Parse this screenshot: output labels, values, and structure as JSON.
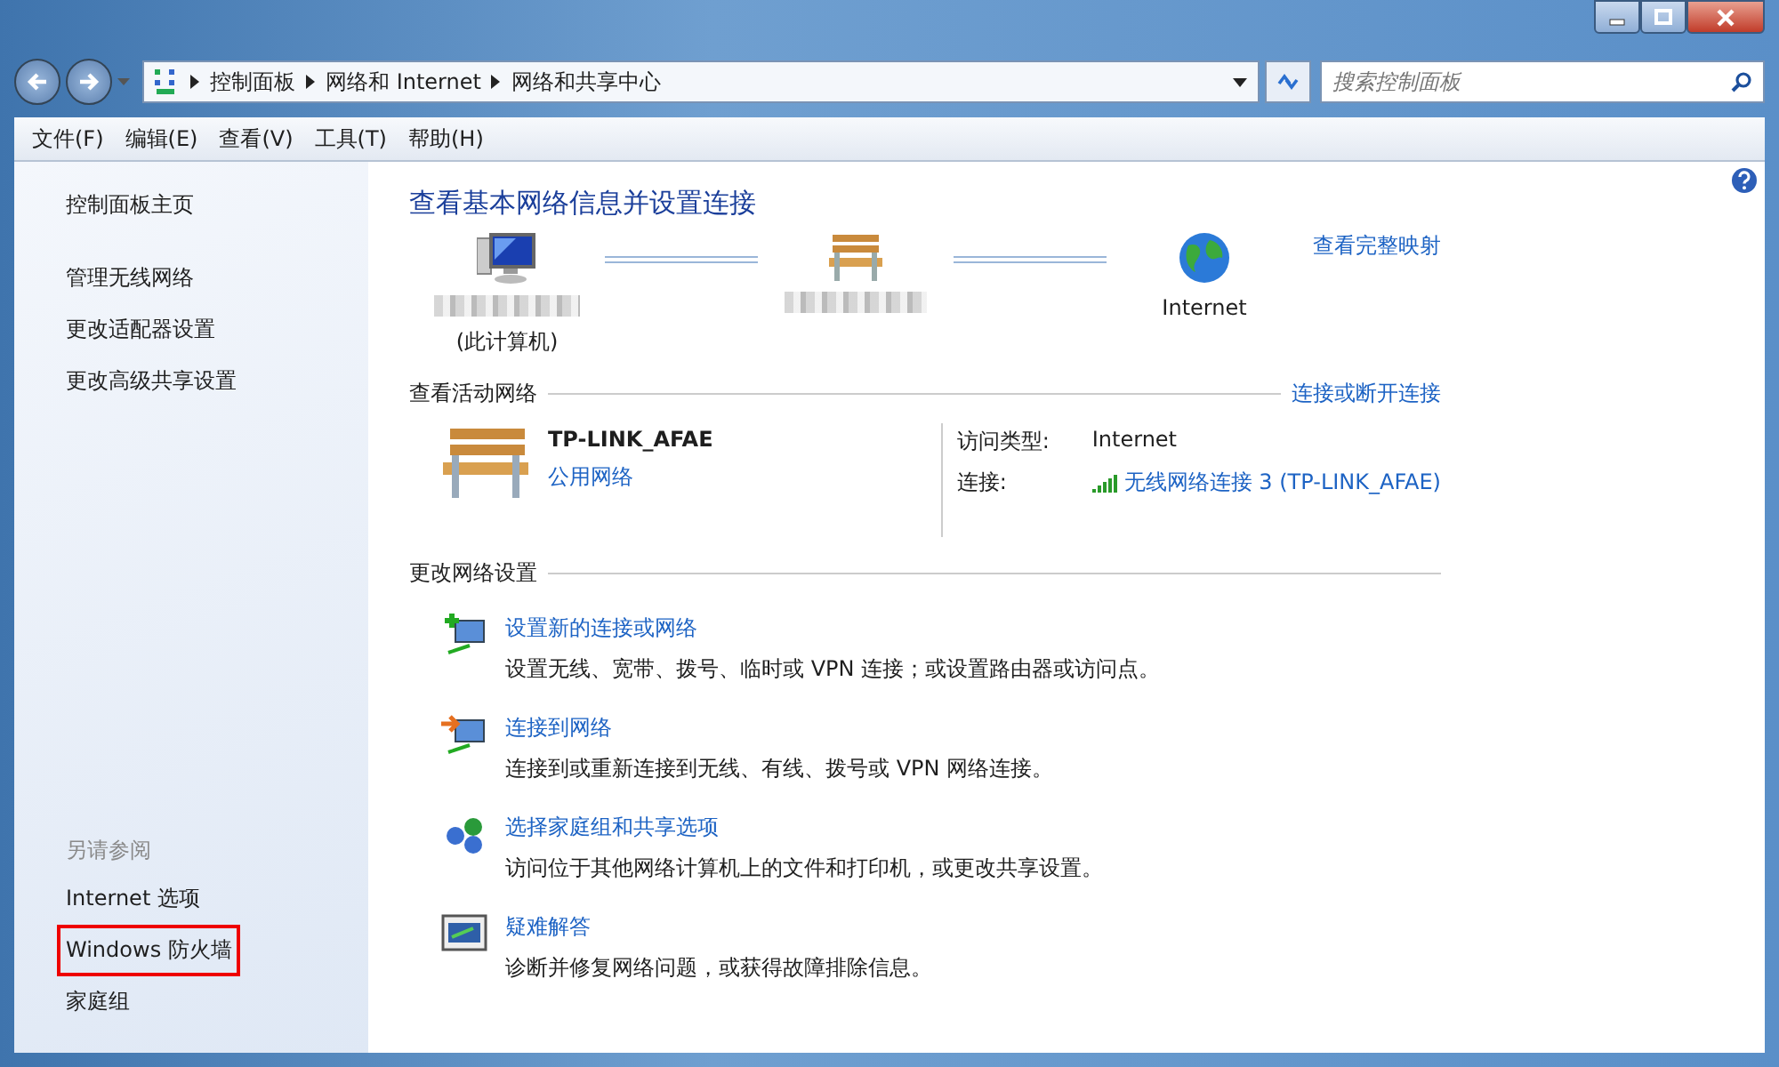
{
  "address_bar": {
    "breadcrumbs": [
      "控制面板",
      "网络和 Internet",
      "网络和共享中心"
    ],
    "search_placeholder": "搜索控制面板"
  },
  "menu": [
    "文件(F)",
    "编辑(E)",
    "查看(V)",
    "工具(T)",
    "帮助(H)"
  ],
  "sidebar": {
    "links": [
      "控制面板主页",
      "管理无线网络",
      "更改适配器设置",
      "更改高级共享设置"
    ],
    "see_also": {
      "heading": "另请参阅",
      "links": [
        {
          "label": "Internet 选项",
          "highlighted": false
        },
        {
          "label": "Windows 防火墙",
          "highlighted": true
        },
        {
          "label": "家庭组",
          "highlighted": false
        }
      ]
    }
  },
  "main": {
    "title": "查看基本网络信息并设置连接",
    "map": {
      "nodes": [
        {
          "kind": "computer",
          "name_obscured": true,
          "label": "(此计算机)"
        },
        {
          "kind": "router",
          "name_obscured": true
        },
        {
          "kind": "internet",
          "name_obscured": false,
          "label": "Internet"
        }
      ],
      "full_map_link": "查看完整映射"
    },
    "active": {
      "heading": "查看活动网络",
      "link": "连接或断开连接",
      "network_name": "TP-LINK_AFAE",
      "network_type": "公用网络",
      "access_label": "访问类型:",
      "access_value": "Internet",
      "connection_label": "连接:",
      "connection_link": "无线网络连接 3 (TP-LINK_AFAE)"
    },
    "change": {
      "heading": "更改网络设置",
      "tasks": [
        {
          "kind": "new",
          "title": "设置新的连接或网络",
          "description": "设置无线、宽带、拨号、临时或 VPN 连接；或设置路由器或访问点。"
        },
        {
          "kind": "connect",
          "title": "连接到网络",
          "description": "连接到或重新连接到无线、有线、拨号或 VPN 网络连接。"
        },
        {
          "kind": "homegroup",
          "title": "选择家庭组和共享选项",
          "description": "访问位于其他网络计算机上的文件和打印机，或更改共享设置。"
        },
        {
          "kind": "troubleshoot",
          "title": "疑难解答",
          "description": "诊断并修复网络问题，或获得故障排除信息。"
        }
      ]
    }
  }
}
